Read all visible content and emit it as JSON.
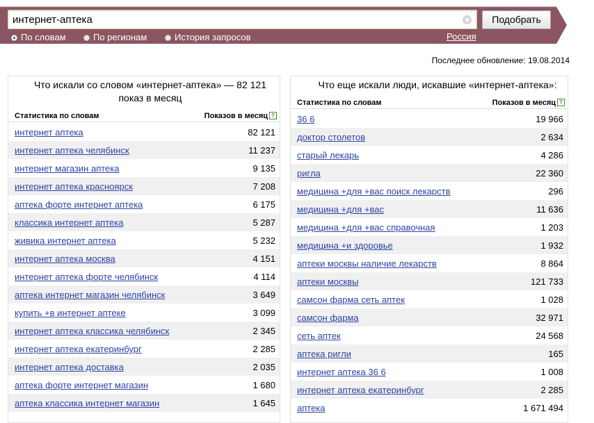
{
  "search": {
    "value": "интернет-аптека",
    "button_label": "Подобрать"
  },
  "search_modes": [
    {
      "label": "По словам",
      "selected": true
    },
    {
      "label": "По регионам",
      "selected": false
    },
    {
      "label": "История запросов",
      "selected": false
    }
  ],
  "region_label": "Россия",
  "last_updated": "Последнее обновление: 19.08.2014",
  "colors": {
    "header": "#8c5562",
    "link": "#2d43a4",
    "row_alt": "#f0f0f0"
  },
  "left_panel": {
    "title": "Что искали со словом «интернет-аптека» — 82 121 показ в месяц",
    "col_keyword": "Статистика по словам",
    "col_count": "Показов в месяц",
    "rows": [
      {
        "keyword": "интернет аптека",
        "count": "82 121"
      },
      {
        "keyword": "интернет аптека челябинск",
        "count": "11 237"
      },
      {
        "keyword": "интернет магазин аптека",
        "count": "9 135"
      },
      {
        "keyword": "интернет аптека красноярск",
        "count": "7 208"
      },
      {
        "keyword": "аптека форте интернет аптека",
        "count": "6 175"
      },
      {
        "keyword": "классика интернет аптека",
        "count": "5 287"
      },
      {
        "keyword": "живика интернет аптека",
        "count": "5 232"
      },
      {
        "keyword": "интернет аптека москва",
        "count": "4 151"
      },
      {
        "keyword": "интернет аптека форте челябинск",
        "count": "4 114"
      },
      {
        "keyword": "аптека интернет магазин челябинск",
        "count": "3 649"
      },
      {
        "keyword": "купить +в интернет аптеке",
        "count": "3 099"
      },
      {
        "keyword": "интернет аптека классика челябинск",
        "count": "2 345"
      },
      {
        "keyword": "интернет аптека екатеринбург",
        "count": "2 285"
      },
      {
        "keyword": "интернет аптека доставка",
        "count": "2 035"
      },
      {
        "keyword": "аптека форте интернет магазин",
        "count": "1 680"
      },
      {
        "keyword": "аптека классика интернет магазин",
        "count": "1 645"
      }
    ]
  },
  "right_panel": {
    "title": "Что еще искали люди, искавшие «интернет-аптека»:",
    "col_keyword": "Статистика по словам",
    "col_count": "Показов в месяц",
    "rows": [
      {
        "keyword": "36 6",
        "count": "19 966"
      },
      {
        "keyword": "доктор столетов",
        "count": "2 634"
      },
      {
        "keyword": "старый лекарь",
        "count": "4 286"
      },
      {
        "keyword": "ригла",
        "count": "22 360"
      },
      {
        "keyword": "медицина +для +вас поиск лекарств",
        "count": "296"
      },
      {
        "keyword": "медицина +для +вас",
        "count": "11 636"
      },
      {
        "keyword": "медицина +для +вас справочная",
        "count": "1 203"
      },
      {
        "keyword": "медицина +и здоровье",
        "count": "1 932"
      },
      {
        "keyword": "аптеки москвы наличие лекарств",
        "count": "8 864"
      },
      {
        "keyword": "аптеки москвы",
        "count": "121 733"
      },
      {
        "keyword": "самсон фарма сеть аптек",
        "count": "1 028"
      },
      {
        "keyword": "самсон фарма",
        "count": "32 971"
      },
      {
        "keyword": "сеть аптек",
        "count": "24 568"
      },
      {
        "keyword": "аптека ригли",
        "count": "165"
      },
      {
        "keyword": "интернет аптека 36 6",
        "count": "1 008"
      },
      {
        "keyword": "интернет аптека екатеринбург",
        "count": "2 285"
      },
      {
        "keyword": "аптека",
        "count": "1 671 494"
      }
    ]
  }
}
